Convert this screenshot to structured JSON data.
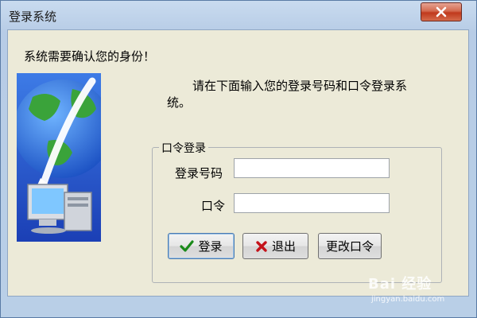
{
  "window": {
    "title": "登录系统"
  },
  "dialog": {
    "prompt": "系统需要确认您的身份！",
    "instruction": "请在下面输入您的登录号码和口令登录系统。"
  },
  "group": {
    "legend": "口令登录",
    "login_label": "登录号码",
    "password_label": "口令",
    "login_value": "",
    "password_value": ""
  },
  "buttons": {
    "login": "登录",
    "exit": "退出",
    "change_password": "更改口令"
  },
  "watermark": {
    "brand": "Bai 经验",
    "url": "jingyan.baidu.com"
  },
  "icons": {
    "close": "close-icon",
    "login": "checkmark-icon",
    "exit": "x-icon",
    "illustration": "globe-computer-icon"
  },
  "colors": {
    "close_button": "#c0391c",
    "check": "#1a8a1a",
    "cross": "#c4121a"
  }
}
